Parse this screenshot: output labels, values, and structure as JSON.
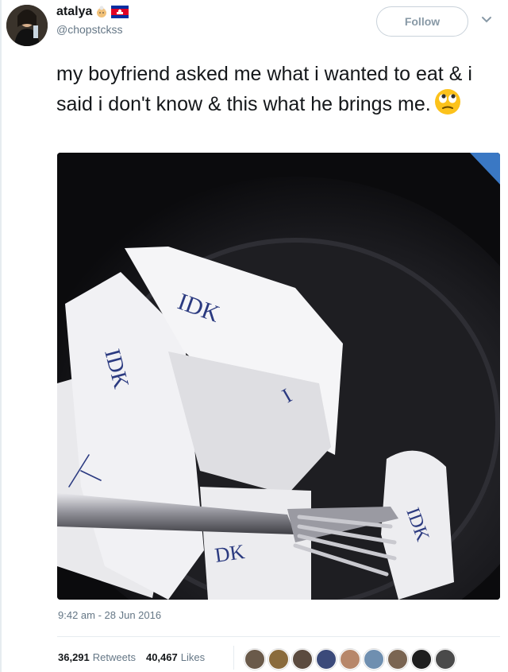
{
  "user": {
    "display_name": "atalya",
    "username": "@chopstckss",
    "name_emojis": [
      "grandmother-emoji-icon",
      "cambodia-flag-icon"
    ]
  },
  "follow_label": "Follow",
  "tweet": {
    "text": "my boyfriend asked me what i wanted to eat & i said i don't know & this what he brings me.",
    "emoji": "face-with-rolling-eyes-icon"
  },
  "photo": {
    "scrawled_notes": [
      "IDK",
      "IDK",
      "I",
      "DK",
      "IDK"
    ]
  },
  "timestamp": "9:42 am - 28 Jun 2016",
  "stats": {
    "retweets_count": "36,291",
    "retweets_label": "Retweets",
    "likes_count": "40,467",
    "likes_label": "Likes"
  },
  "likers": [
    {
      "avatar": "liker-avatar-1",
      "color": "#6a5a4a"
    },
    {
      "avatar": "liker-avatar-2",
      "color": "#8a6b3c"
    },
    {
      "avatar": "liker-avatar-3",
      "color": "#5b4b3f"
    },
    {
      "avatar": "liker-avatar-4",
      "color": "#3b4a7a"
    },
    {
      "avatar": "liker-avatar-5",
      "color": "#b7876a"
    },
    {
      "avatar": "liker-avatar-6",
      "color": "#6f8fb0"
    },
    {
      "avatar": "liker-avatar-7",
      "color": "#7a6552"
    },
    {
      "avatar": "liker-avatar-8",
      "color": "#1e1e1e"
    },
    {
      "avatar": "liker-avatar-9",
      "color": "#4a4a4a"
    }
  ],
  "colors": {
    "text": "#14171a",
    "secondary": "#657786",
    "border": "#e6ecf0",
    "follow_border": "#c9d2da"
  }
}
